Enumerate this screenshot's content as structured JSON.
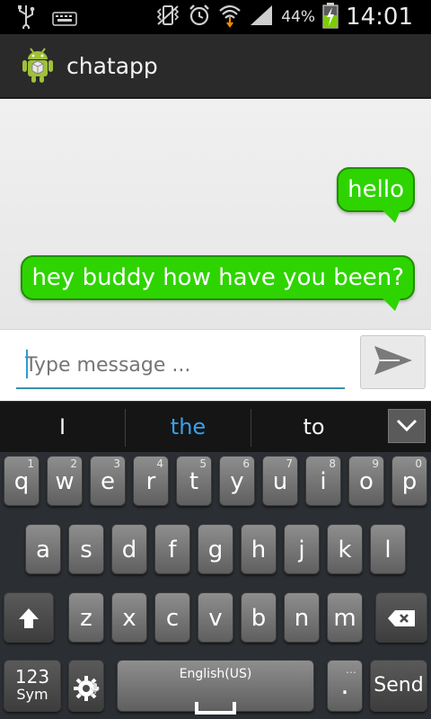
{
  "status_bar": {
    "battery_percent": "44%",
    "time": "14:01",
    "icons": [
      "usb-icon",
      "keyboard-icon",
      "vibrate-icon",
      "alarm-icon",
      "wifi-icon",
      "signal-icon",
      "battery-charging-icon"
    ]
  },
  "action_bar": {
    "title": "chatapp",
    "logo_icon": "android-icon"
  },
  "messages": [
    {
      "text": "hello"
    },
    {
      "text": "hey buddy how have you been?"
    }
  ],
  "composer": {
    "placeholder": "Type message ...",
    "send_icon": "send-icon"
  },
  "suggestions": [
    "I",
    "the",
    "to"
  ],
  "suggestion_highlight_color": "#3aa0e8",
  "keyboard": {
    "row1": [
      [
        "q",
        "1"
      ],
      [
        "w",
        "2"
      ],
      [
        "e",
        "3"
      ],
      [
        "r",
        "4"
      ],
      [
        "t",
        "5"
      ],
      [
        "y",
        "6"
      ],
      [
        "u",
        "7"
      ],
      [
        "i",
        "8"
      ],
      [
        "o",
        "9"
      ],
      [
        "p",
        "0"
      ]
    ],
    "row2": [
      "a",
      "s",
      "d",
      "f",
      "g",
      "h",
      "j",
      "k",
      "l"
    ],
    "row3": [
      "z",
      "x",
      "c",
      "v",
      "b",
      "n",
      "m"
    ],
    "sym_label_top": "123",
    "sym_label_bottom": "Sym",
    "space_label": "English(US)",
    "period": ".",
    "send_label": "Send"
  },
  "colors": {
    "bubble": "#2ed400",
    "action_bar": "#2a2a2a",
    "input_underline": "#3a8fb0"
  }
}
